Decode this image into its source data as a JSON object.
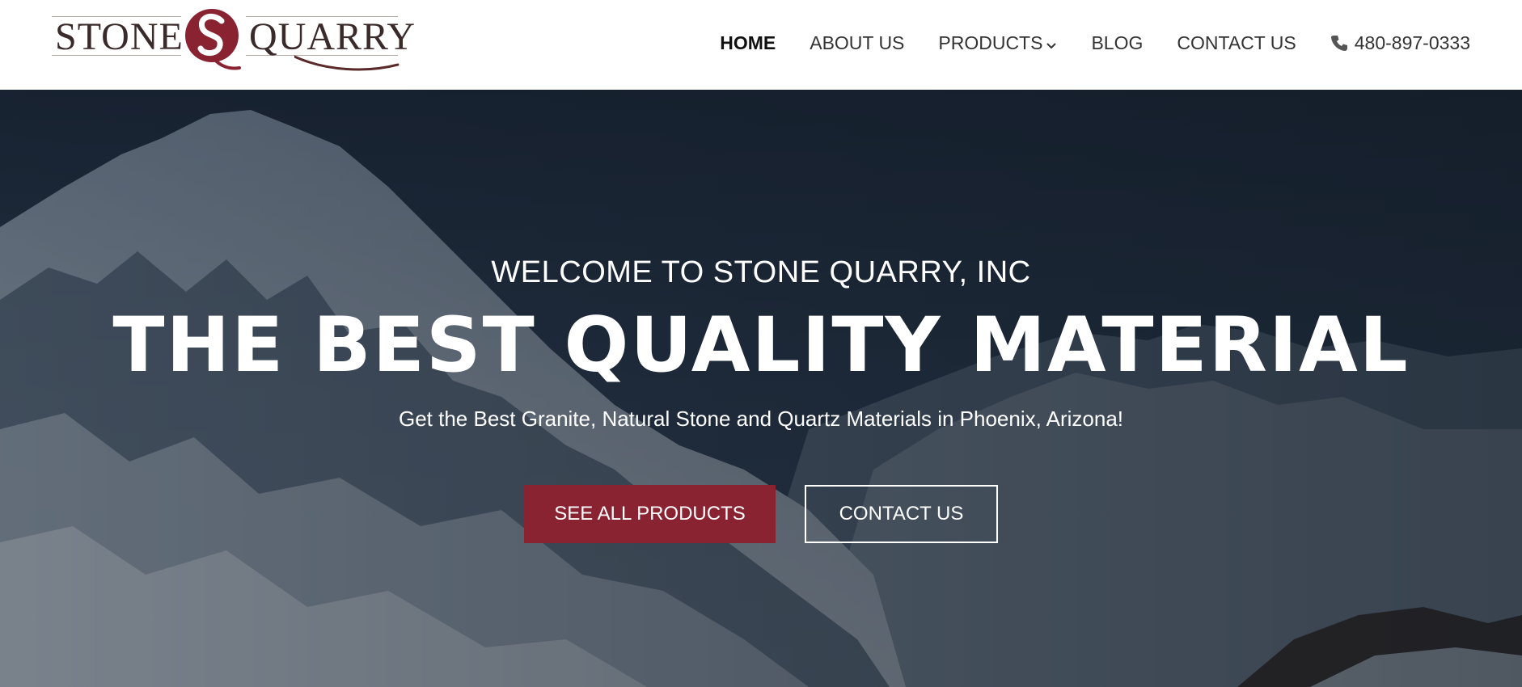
{
  "brand": {
    "name_left": "STONE",
    "name_right": "QUARRY",
    "mark_letters": "SQ",
    "primary_color": "#8a2331"
  },
  "nav": {
    "items": [
      {
        "label": "HOME",
        "active": true
      },
      {
        "label": "ABOUT US",
        "active": false
      },
      {
        "label": "PRODUCTS",
        "active": false,
        "has_dropdown": true
      },
      {
        "label": "BLOG",
        "active": false
      },
      {
        "label": "CONTACT US",
        "active": false
      }
    ],
    "phone": "480-897-0333",
    "phone_icon": "phone-icon",
    "dropdown_icon": "chevron-down-icon"
  },
  "hero": {
    "eyebrow": "WELCOME TO STONE QUARRY, INC",
    "title": "THE BEST QUALITY MATERIAL",
    "subtitle": "Get the Best Granite, Natural Stone and Quartz Materials in Phoenix, Arizona!",
    "primary_button": "SEE ALL PRODUCTS",
    "secondary_button": "CONTACT US",
    "background": "snowy-mountain-photo",
    "overlay_color": "#1b2635"
  }
}
